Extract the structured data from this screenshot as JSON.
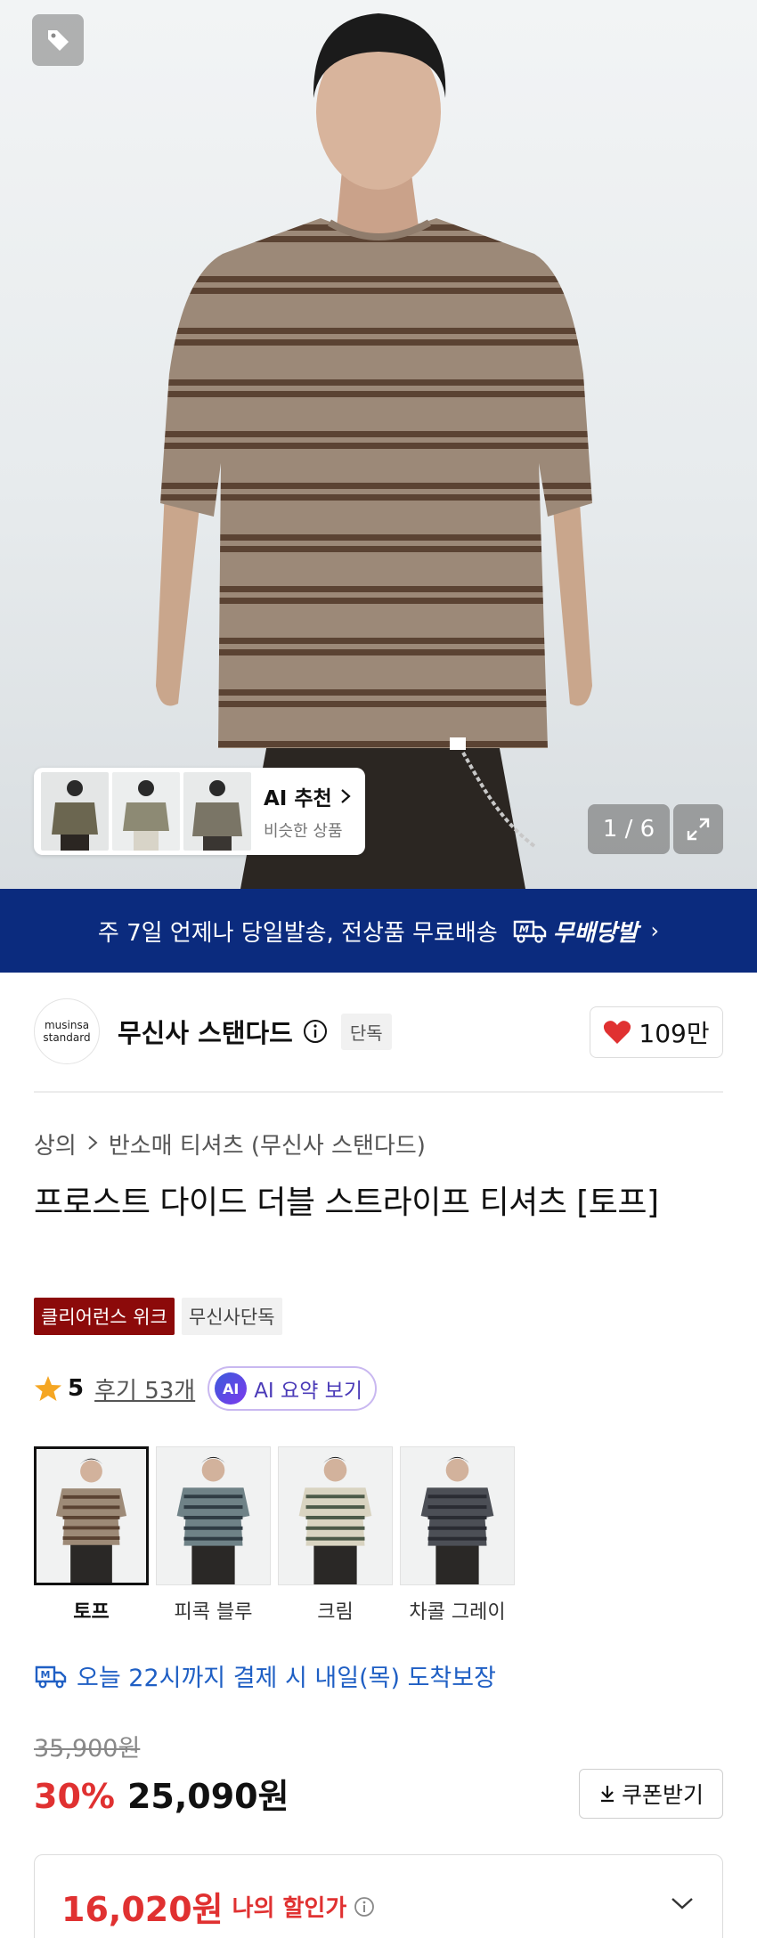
{
  "gallery": {
    "counter": "1 / 6",
    "ai_reco": {
      "title": "AI 추천",
      "subtitle": "비슷한 상품"
    }
  },
  "banner": {
    "text": "주 7일 언제나 당일발송, 전상품 무료배송",
    "brand_label": "무배당발"
  },
  "brand": {
    "logo_line1": "musinsa",
    "logo_line2": "standard",
    "name": "무신사 스탠다드",
    "exclusive_badge": "단독",
    "likes": "109만"
  },
  "breadcrumb": {
    "category": "상의",
    "subcategory": "반소매 티셔츠 (무신사 스탠다드)"
  },
  "product": {
    "title": "프로스트 다이드 더블 스트라이프 티셔츠 [토프]",
    "badges": [
      "클리어런스 위크",
      "무신사단독"
    ],
    "rating": "5",
    "reviews": "후기 53개",
    "ai_summary": "AI 요약 보기"
  },
  "colors": [
    {
      "name": "토프",
      "selected": true,
      "shirt": "#9d8a77",
      "stripe": "#5a4232"
    },
    {
      "name": "피콕 블루",
      "selected": false,
      "shirt": "#6f8287",
      "stripe": "#2f3c44"
    },
    {
      "name": "크림",
      "selected": false,
      "shirt": "#d9d4c1",
      "stripe": "#4c5a48"
    },
    {
      "name": "차콜 그레이",
      "selected": false,
      "shirt": "#4c4f56",
      "stripe": "#2a2c33"
    }
  ],
  "delivery": {
    "text": "오늘 22시까지 결제 시 내일(목) 도착보장"
  },
  "price": {
    "original": "35,900원",
    "discount": "30%",
    "sale": "25,090원",
    "coupon_label": "쿠폰받기",
    "my_price": "16,020원",
    "my_price_label": "나의 할인가"
  },
  "theme": {
    "banner_bg": "#0b2b7e",
    "accent_red": "#e03131",
    "badge_red": "#8c0a0a",
    "delivery_blue": "#1f5fc4"
  }
}
